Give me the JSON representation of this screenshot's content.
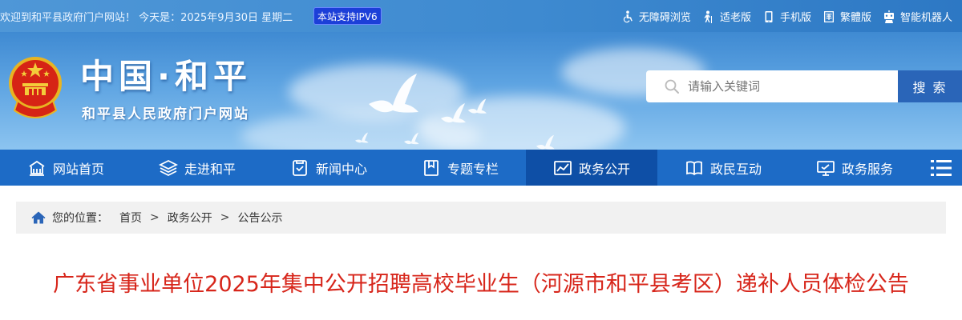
{
  "topbar": {
    "welcome": "欢迎到和平县政府门户网站！  今天是：2025年9月30日 星期二",
    "ipv6_badge": "本站支持IPV6",
    "links": [
      {
        "label": "无障碍浏览",
        "icon": "accessibility-icon"
      },
      {
        "label": "适老版",
        "icon": "elderly-icon"
      },
      {
        "label": "手机版",
        "icon": "mobile-icon"
      },
      {
        "label": "繁體版",
        "icon": "traditional-chinese-icon"
      },
      {
        "label": "智能机器人",
        "icon": "robot-icon"
      }
    ]
  },
  "banner": {
    "title": "中国·和平",
    "subtitle": "和平县人民政府门户网站",
    "emblem": "national-emblem"
  },
  "search": {
    "placeholder": "请输入关键词",
    "button_label": "搜 索"
  },
  "nav": {
    "items": [
      {
        "label": "网站首页",
        "icon": "home-icon"
      },
      {
        "label": "走进和平",
        "icon": "layers-icon"
      },
      {
        "label": "新闻中心",
        "icon": "news-icon"
      },
      {
        "label": "专题专栏",
        "icon": "bookmark-icon"
      },
      {
        "label": "政务公开",
        "icon": "chart-icon",
        "active": true
      },
      {
        "label": "政民互动",
        "icon": "book-icon"
      },
      {
        "label": "政务服务",
        "icon": "monitor-icon"
      }
    ],
    "menu_icon": "menu-icon"
  },
  "breadcrumb": {
    "label": "您的位置：",
    "items": [
      "首页",
      "政务公开",
      "公告公示"
    ],
    "separator": ">"
  },
  "article": {
    "title": "广东省事业单位2025年集中公开招聘高校毕业生（河源市和平县考区）递补人员体检公告"
  },
  "colors": {
    "nav_bg": "#1d6bc6",
    "nav_active": "#0e4fa6",
    "title_red": "#d7261b",
    "ipv6_bg": "#1c3fd8"
  }
}
